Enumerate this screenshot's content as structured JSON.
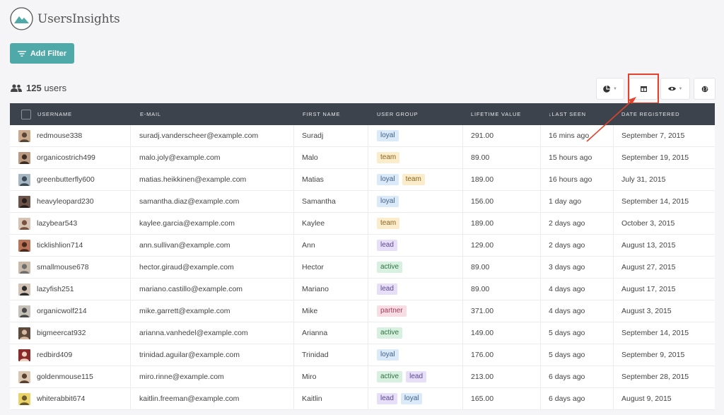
{
  "app": {
    "name": "UsersInsights"
  },
  "toolbar": {
    "add_filter_label": "Add Filter",
    "user_count": "125",
    "user_count_suffix": "users"
  },
  "colors": {
    "accent": "#4fa9a8",
    "header_bg": "#3c434c",
    "highlight": "#e2432a"
  },
  "table": {
    "columns": [
      "Username",
      "E-mail",
      "First Name",
      "User Group",
      "Lifetime Value",
      "↓Last Seen",
      "Date Registered"
    ],
    "rows": [
      {
        "username": "redmouse338",
        "email": "suradj.vanderscheer@example.com",
        "first": "Suradj",
        "groups": [
          "loyal"
        ],
        "value": "291.00",
        "seen": "16 mins ago",
        "registered": "September 7, 2015"
      },
      {
        "username": "organicostrich499",
        "email": "malo.joly@example.com",
        "first": "Malo",
        "groups": [
          "team"
        ],
        "value": "89.00",
        "seen": "15 hours ago",
        "registered": "September 19, 2015"
      },
      {
        "username": "greenbutterfly600",
        "email": "matias.heikkinen@example.com",
        "first": "Matias",
        "groups": [
          "loyal",
          "team"
        ],
        "value": "189.00",
        "seen": "16 hours ago",
        "registered": "July 31, 2015"
      },
      {
        "username": "heavyleopard230",
        "email": "samantha.diaz@example.com",
        "first": "Samantha",
        "groups": [
          "loyal"
        ],
        "value": "156.00",
        "seen": "1 day ago",
        "registered": "September 14, 2015"
      },
      {
        "username": "lazybear543",
        "email": "kaylee.garcia@example.com",
        "first": "Kaylee",
        "groups": [
          "team"
        ],
        "value": "189.00",
        "seen": "2 days ago",
        "registered": "October 3, 2015"
      },
      {
        "username": "ticklishlion714",
        "email": "ann.sullivan@example.com",
        "first": "Ann",
        "groups": [
          "lead"
        ],
        "value": "129.00",
        "seen": "2 days ago",
        "registered": "August 13, 2015"
      },
      {
        "username": "smallmouse678",
        "email": "hector.giraud@example.com",
        "first": "Hector",
        "groups": [
          "active"
        ],
        "value": "89.00",
        "seen": "3 days ago",
        "registered": "August 27, 2015"
      },
      {
        "username": "lazyfish251",
        "email": "mariano.castillo@example.com",
        "first": "Mariano",
        "groups": [
          "lead"
        ],
        "value": "89.00",
        "seen": "4 days ago",
        "registered": "August 17, 2015"
      },
      {
        "username": "organicwolf214",
        "email": "mike.garrett@example.com",
        "first": "Mike",
        "groups": [
          "partner"
        ],
        "value": "371.00",
        "seen": "4 days ago",
        "registered": "August 3, 2015"
      },
      {
        "username": "bigmeercat932",
        "email": "arianna.vanhedel@example.com",
        "first": "Arianna",
        "groups": [
          "active"
        ],
        "value": "149.00",
        "seen": "5 days ago",
        "registered": "September 14, 2015"
      },
      {
        "username": "redbird409",
        "email": "trinidad.aguilar@example.com",
        "first": "Trinidad",
        "groups": [
          "loyal"
        ],
        "value": "176.00",
        "seen": "5 days ago",
        "registered": "September 9, 2015"
      },
      {
        "username": "goldenmouse115",
        "email": "miro.rinne@example.com",
        "first": "Miro",
        "groups": [
          "active",
          "lead"
        ],
        "value": "213.00",
        "seen": "6 days ago",
        "registered": "September 28, 2015"
      },
      {
        "username": "whiterabbit674",
        "email": "kaitlin.freeman@example.com",
        "first": "Kaitlin",
        "groups": [
          "lead",
          "loyal"
        ],
        "value": "165.00",
        "seen": "6 days ago",
        "registered": "August 9, 2015"
      }
    ]
  }
}
